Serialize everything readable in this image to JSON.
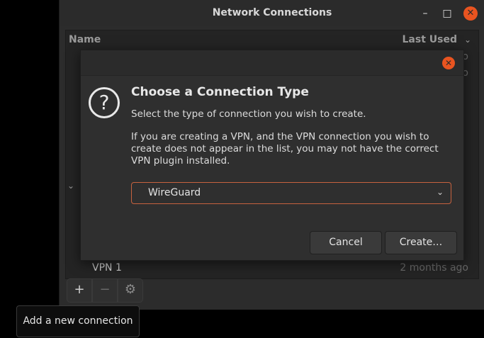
{
  "window": {
    "title": "Network Connections",
    "minimize_icon": "minimize-icon",
    "maximize_icon": "maximize-icon",
    "close_icon": "close-icon"
  },
  "list": {
    "col_name": "Name",
    "col_last_used": "Last Used",
    "hidden_rows": [
      {
        "last_used": "ago"
      },
      {
        "last_used": "ago"
      }
    ],
    "vpn_row": {
      "name": "VPN 1",
      "last_used": "2 months ago"
    }
  },
  "toolbar": {
    "add_label": "+",
    "remove_label": "−",
    "settings_label": "⚙"
  },
  "dialog": {
    "heading": "Choose a Connection Type",
    "subtitle": "Select the type of connection you wish to create.",
    "note": "If you are creating a VPN, and the VPN connection you wish to create does not appear in the list, you may not have the correct VPN plugin installed.",
    "selected_type": "WireGuard",
    "cancel_label": "Cancel",
    "create_label": "Create…",
    "icon": "question-icon"
  },
  "tooltip": {
    "text": "Add a new connection"
  },
  "colors": {
    "accent": "#e95420",
    "background": "#2c2c2c"
  }
}
